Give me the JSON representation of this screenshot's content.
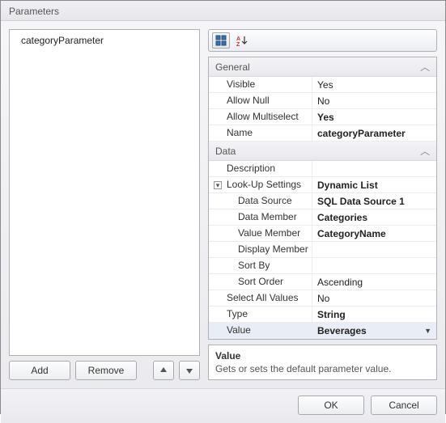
{
  "window": {
    "title": "Parameters"
  },
  "list": {
    "items": [
      "categoryParameter"
    ]
  },
  "buttons": {
    "add": "Add",
    "remove": "Remove"
  },
  "toolbar": {
    "categorized": "categorized",
    "alphabetical": "alphabetical"
  },
  "grid": {
    "categories": {
      "general": "General",
      "data": "Data"
    },
    "general": {
      "visible_label": "Visible",
      "visible": "Yes",
      "allowNull_label": "Allow Null",
      "allowNull": "No",
      "allowMulti_label": "Allow Multiselect",
      "allowMulti": "Yes",
      "name_label": "Name",
      "name": "categoryParameter"
    },
    "data": {
      "description_label": "Description",
      "description": "",
      "lookup_label": "Look-Up Settings",
      "lookup": "Dynamic List",
      "dataSource_label": "Data Source",
      "dataSource": "SQL Data Source 1",
      "dataMember_label": "Data Member",
      "dataMember": "Categories",
      "valueMember_label": "Value Member",
      "valueMember": "CategoryName",
      "displayMember_label": "Display Member",
      "displayMember": "",
      "sortBy_label": "Sort By",
      "sortBy": "",
      "sortOrder_label": "Sort Order",
      "sortOrder": "Ascending",
      "selectAll_label": "Select All Values",
      "selectAll": "No",
      "type_label": "Type",
      "type": "String",
      "value_label": "Value",
      "value": "Beverages"
    }
  },
  "desc": {
    "title": "Value",
    "text": "Gets or sets the default parameter value."
  },
  "footer": {
    "ok": "OK",
    "cancel": "Cancel"
  }
}
